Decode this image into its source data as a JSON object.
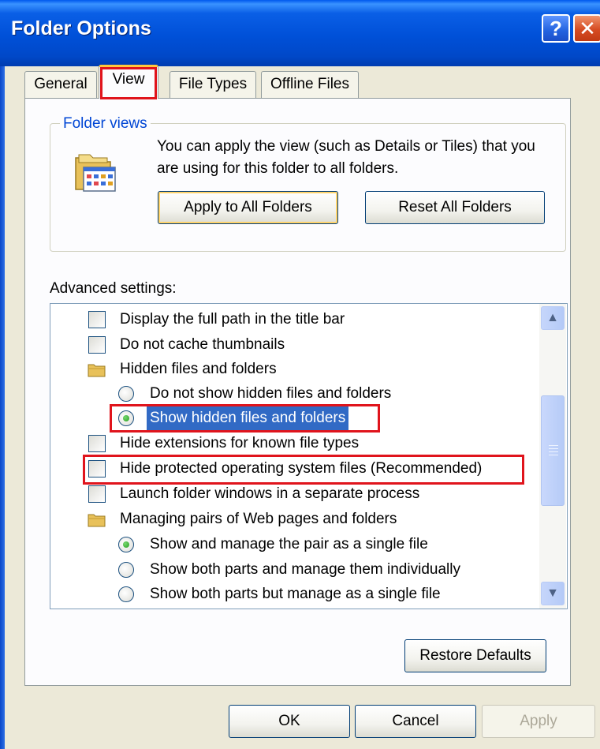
{
  "window": {
    "title": "Folder Options",
    "help_button": "?",
    "close_button": "✕"
  },
  "tabs": [
    {
      "label": "General",
      "selected": false
    },
    {
      "label": "View",
      "selected": true
    },
    {
      "label": "File Types",
      "selected": false
    },
    {
      "label": "Offline Files",
      "selected": false
    }
  ],
  "folder_views": {
    "label": "Folder views",
    "description": "You can apply the view (such as Details or Tiles) that you are using for this folder to all folders.",
    "apply_all_label": "Apply to All Folders",
    "reset_all_label": "Reset All Folders"
  },
  "advanced": {
    "label": "Advanced settings:",
    "items": [
      {
        "kind": "checkbox",
        "label": "Display the full path in the title bar",
        "checked": false
      },
      {
        "kind": "checkbox",
        "label": "Do not cache thumbnails",
        "checked": false
      },
      {
        "kind": "folder",
        "label": "Hidden files and folders"
      },
      {
        "kind": "radio",
        "label": "Do not show hidden files and folders",
        "selected": false
      },
      {
        "kind": "radio",
        "label": "Show hidden files and folders",
        "selected": true,
        "highlighted": true
      },
      {
        "kind": "checkbox",
        "label": "Hide extensions for known file types",
        "checked": false
      },
      {
        "kind": "checkbox",
        "label": "Hide protected operating system files (Recommended)",
        "checked": false
      },
      {
        "kind": "checkbox",
        "label": "Launch folder windows in a separate process",
        "checked": false
      },
      {
        "kind": "folder",
        "label": "Managing pairs of Web pages and folders"
      },
      {
        "kind": "radio",
        "label": "Show and manage the pair as a single file",
        "selected": true
      },
      {
        "kind": "radio",
        "label": "Show both parts and manage them individually",
        "selected": false
      },
      {
        "kind": "radio",
        "label": "Show both parts but manage as a single file",
        "selected": false
      }
    ]
  },
  "buttons": {
    "restore": "Restore Defaults",
    "ok": "OK",
    "cancel": "Cancel",
    "apply": "Apply"
  },
  "colors": {
    "titlebar": "#0050d8",
    "selection": "#316ac5",
    "annotation": "#e0141c",
    "group_label": "#0046d5"
  }
}
